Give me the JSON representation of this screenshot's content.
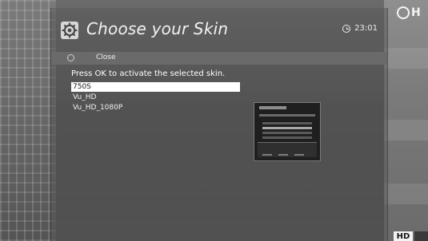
{
  "window": {
    "title": "Choose your Skin",
    "clock": "23:01"
  },
  "close": {
    "label": "Close"
  },
  "instruction": "Press OK to activate the selected skin.",
  "skins": [
    {
      "label": "750S",
      "selected": true
    },
    {
      "label": "Vu_HD",
      "selected": false
    },
    {
      "label": "Vu_HD_1080P",
      "selected": false
    }
  ],
  "channel": {
    "logo_text": "H",
    "badge": "HD"
  },
  "icons": {
    "title_icon": "gear-icon",
    "clock_icon": "clock-icon",
    "close_button_icon": "circle-button-icon"
  }
}
